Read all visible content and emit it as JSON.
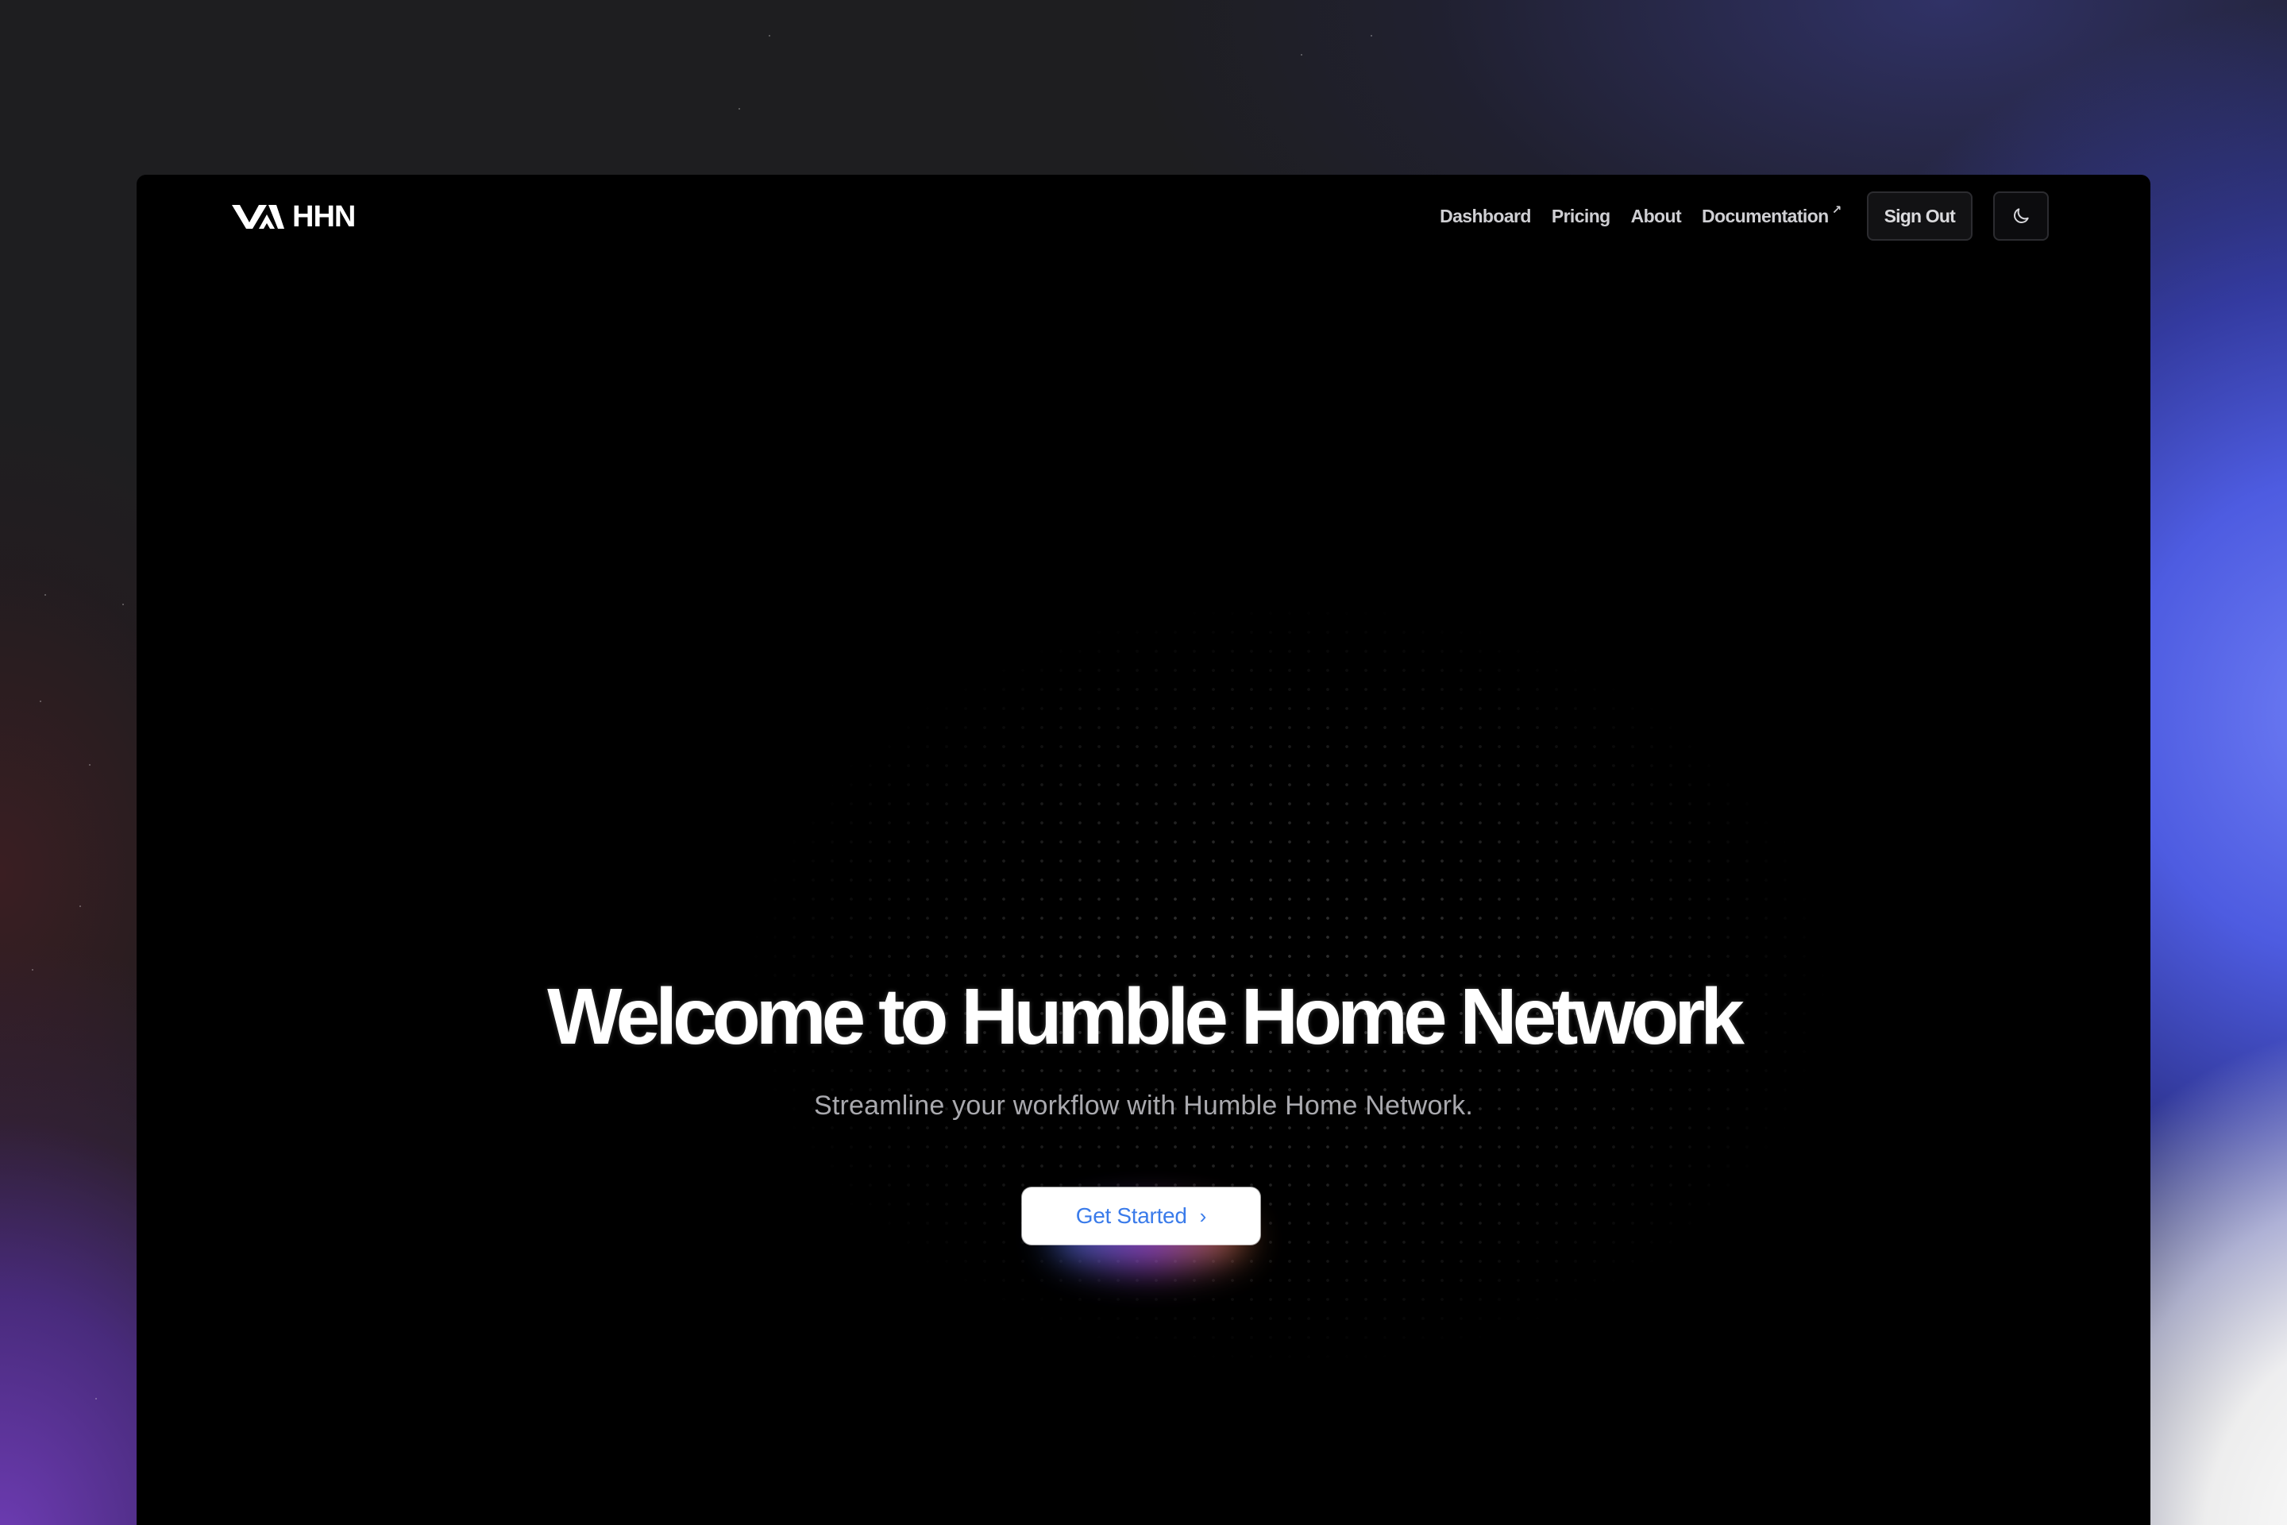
{
  "brand": {
    "name": "HHN",
    "logo_icon": "hhn-logo-icon"
  },
  "nav": {
    "links": [
      {
        "label": "Dashboard"
      },
      {
        "label": "Pricing"
      },
      {
        "label": "About"
      },
      {
        "label": "Documentation",
        "external_icon": "arrow-up-right-icon"
      }
    ],
    "sign_out_label": "Sign Out",
    "theme_toggle_icon": "moon-icon"
  },
  "hero": {
    "title": "Welcome to Humble Home Network",
    "subtitle": "Streamline your workflow with Humble Home Network.",
    "cta_label": "Get Started",
    "cta_icon": "chevron-right-icon"
  },
  "colors": {
    "accent": "#3a7bea",
    "page_background": "#000000"
  }
}
